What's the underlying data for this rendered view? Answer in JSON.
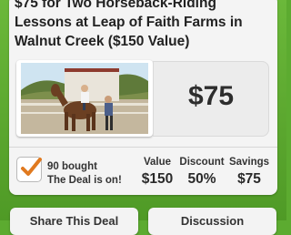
{
  "deal": {
    "title": "$75 for Two Horseback-Riding Lessons at Leap of Faith Farms in Walnut Creek ($150 Value)",
    "price": "$75",
    "photo_alt": "horseback-riding-lesson-photo"
  },
  "status": {
    "bought_count": "90 bought",
    "deal_status": "The Deal is on!",
    "check_color": "#e07a20"
  },
  "stats": [
    {
      "label": "Value",
      "value": "$150"
    },
    {
      "label": "Discount",
      "value": "50%"
    },
    {
      "label": "Savings",
      "value": "$75"
    }
  ],
  "actions": {
    "share_label": "Share This Deal",
    "discussion_label": "Discussion"
  },
  "colors": {
    "background_green": "#5cab30",
    "card": "#f4f4f4"
  }
}
